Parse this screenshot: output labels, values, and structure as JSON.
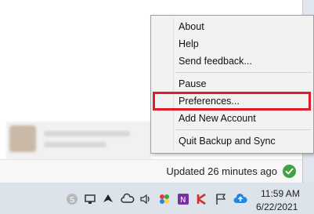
{
  "menu": {
    "items": [
      {
        "label": "About"
      },
      {
        "label": "Help"
      },
      {
        "label": "Send feedback..."
      },
      {
        "label": "Pause"
      },
      {
        "label": "Preferences..."
      },
      {
        "label": "Add New Account"
      },
      {
        "label": "Quit Backup and Sync"
      }
    ],
    "highlighted_item": "Preferences...",
    "highlight_color": "#e01b2a"
  },
  "status": {
    "text": "Updated 26 minutes ago",
    "icon": "check-circle-icon",
    "icon_color": "#43a047"
  },
  "taskbar": {
    "tray_icons": [
      "skype-icon",
      "network-device-icon",
      "bird-icon",
      "cloud-icon",
      "speaker-icon",
      "colorful-dots-icon",
      "onenote-icon",
      "kaspersky-icon",
      "flag-icon",
      "cloud-upload-icon"
    ],
    "time": "11:59 AM",
    "date": "6/22/2021"
  }
}
